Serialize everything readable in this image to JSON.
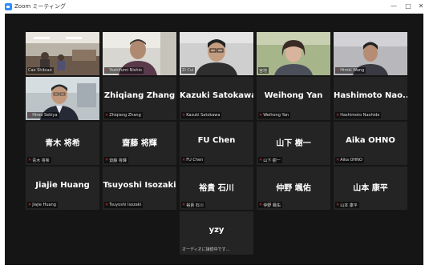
{
  "window": {
    "title": "Zoom ミーティング",
    "minimize": "—",
    "maximize": "□",
    "close": "✕"
  },
  "participants": [
    {
      "label": "Cao Shibiao",
      "video": "room"
    },
    {
      "label": "Yoshifumi Nishio",
      "video": "person"
    },
    {
      "label": "Zi Cui",
      "video": "person"
    },
    {
      "label": "宮地 ",
      "video": "person"
    },
    {
      "label": "Hiroki Wang",
      "video": "person"
    },
    {
      "label": "Hiroo Sekiya",
      "video": "person"
    },
    {
      "name": "Zhiqiang Zhang",
      "label": "Zhiqiang Zhang"
    },
    {
      "name": "Kazuki Satokawa",
      "label": "Kazuki Satokawa"
    },
    {
      "name": "Weihong Yan",
      "label": "Weihong Yan"
    },
    {
      "name": "Hashimoto  Nao...",
      "label": "Hashimoto Naohide"
    },
    {
      "name": "青木  将希",
      "label": "青木 将希"
    },
    {
      "name": "齋藤  将輝",
      "label": "齋藤 将輝"
    },
    {
      "name": "FU Chen",
      "label": "FU Chen"
    },
    {
      "name": "山下  樹一",
      "label": "山下 樹一"
    },
    {
      "name": "Aika OHNO",
      "label": "Aika OHNO"
    },
    {
      "name": "Jiajie Huang",
      "label": "Jiajie Huang"
    },
    {
      "name": "Tsuyoshi Isozaki",
      "label": "Tsuyoshi Isozaki"
    },
    {
      "name": "裕貴  石川",
      "label": "裕貴 石川"
    },
    {
      "name": "仲野  颯佑",
      "label": "仲野 颯佑"
    },
    {
      "name": "山本  康平",
      "label": "山本 康平"
    },
    {
      "name": "yzy",
      "label": "オーディオに接続中です..."
    }
  ],
  "colors": {
    "background": "#151515",
    "tile": "#242424",
    "active_speaker": "#7dd24a",
    "muted": "#e03a3a"
  }
}
